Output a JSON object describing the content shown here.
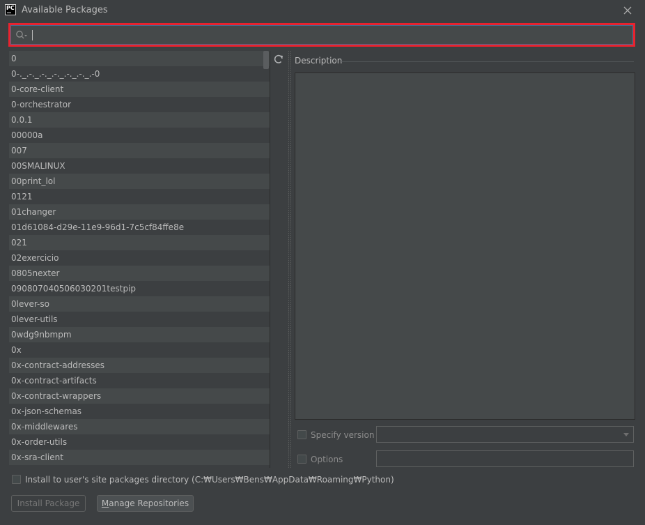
{
  "window": {
    "title": "Available Packages",
    "app_logo_text": "PC"
  },
  "search": {
    "value": "",
    "placeholder": ""
  },
  "packages": [
    "0",
    "0-._.-._.-._.-._.-._.-._.-0",
    "0-core-client",
    "0-orchestrator",
    "0.0.1",
    "00000a",
    "007",
    "00SMALINUX",
    "00print_lol",
    "0121",
    "01changer",
    "01d61084-d29e-11e9-96d1-7c5cf84ffe8e",
    "021",
    "02exercicio",
    "0805nexter",
    "090807040506030201testpip",
    "0lever-so",
    "0lever-utils",
    "0wdg9nbmpm",
    "0x",
    "0x-contract-addresses",
    "0x-contract-artifacts",
    "0x-contract-wrappers",
    "0x-json-schemas",
    "0x-middlewares",
    "0x-order-utils",
    "0x-sra-client"
  ],
  "description": {
    "label": "Description",
    "text": ""
  },
  "specify_version": {
    "label": "Specify version",
    "checked": false,
    "value": ""
  },
  "options": {
    "label": "Options",
    "checked": false,
    "value": ""
  },
  "install_user": {
    "label": "Install to user's site packages directory (C:₩Users₩Bens₩AppData₩Roaming₩Python)",
    "checked": false
  },
  "buttons": {
    "install_label": "Install Package",
    "manage_label_first": "M",
    "manage_label_rest": "anage Repositories"
  },
  "colors": {
    "highlight": "#e8232f",
    "background": "#3c3f41",
    "alt_row": "#45494a",
    "focus_border": "#466d94"
  }
}
